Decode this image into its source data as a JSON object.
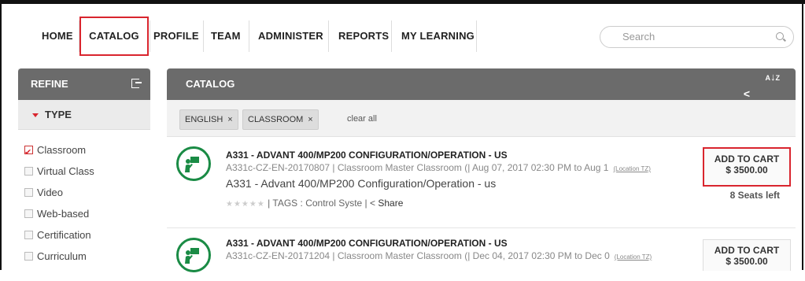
{
  "nav": {
    "items": [
      "HOME",
      "CATALOG",
      "PROFILE",
      "TEAM",
      "ADMINISTER",
      "REPORTS",
      "MY LEARNING"
    ],
    "search_placeholder": "Search"
  },
  "refine": {
    "title": "REFINE",
    "type_label": "TYPE",
    "filters": [
      "Classroom",
      "Virtual Class",
      "Video",
      "Web-based",
      "Certification",
      "Curriculum"
    ]
  },
  "catalog": {
    "title": "CATALOG",
    "chips": [
      "ENGLISH",
      "CLASSROOM"
    ],
    "clear_all": "clear all",
    "items": [
      {
        "title": "A331 - ADVANT 400/MP200 CONFIGURATION/OPERATION - US",
        "meta": "A331c-CZ-EN-20170807 | Classroom Master Classroom (| Aug 07, 2017 02:30 PM to Aug 1",
        "tz": "(Location TZ)",
        "desc": "A331 - Advant 400/MP200 Configuration/Operation - us",
        "tags": "| TAGS : Control Syste | ",
        "share": "Share",
        "cart_label": "ADD TO CART",
        "price": "$ 3500.00",
        "seats": "8 Seats left"
      },
      {
        "title": "A331 - ADVANT 400/MP200 CONFIGURATION/OPERATION - US",
        "meta": "A331c-CZ-EN-20171204 | Classroom Master Classroom (| Dec 04, 2017 02:30 PM to Dec 0",
        "tz": "(Location TZ)",
        "cart_label": "ADD TO CART",
        "price": "$ 3500.00"
      }
    ]
  },
  "colors": {
    "accent_red": "#d9252e",
    "panel_gray": "#6b6b6b",
    "logo_green": "#1a8b45"
  }
}
